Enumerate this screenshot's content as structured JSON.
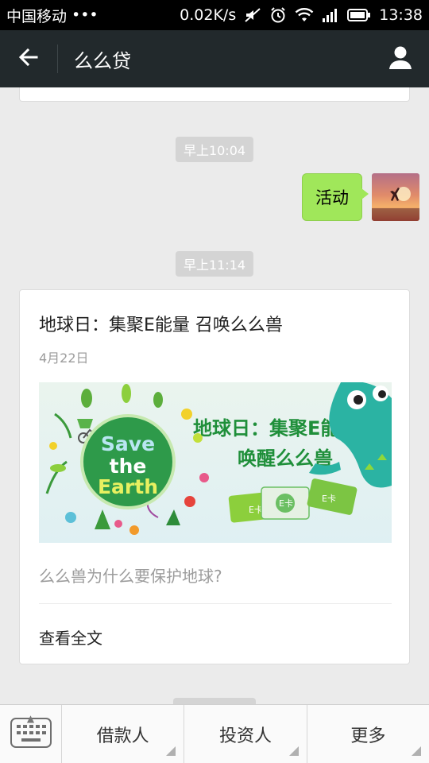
{
  "status_bar": {
    "carrier": "中国移动",
    "dots": "•••",
    "speed": "0.02K/s",
    "time": "13:38",
    "icons": [
      "mute-icon",
      "alarm-icon",
      "wifi-icon",
      "signal-icon",
      "battery-icon"
    ]
  },
  "header": {
    "title": "么么贷",
    "back_icon": "back-arrow-icon",
    "profile_icon": "person-icon"
  },
  "chat": {
    "time_1": "早上10:04",
    "sent_message": "活动",
    "time_2": "早上11:14",
    "article": {
      "title": "地球日：集聚E能量  召唤么么兽",
      "date": "4月22日",
      "image": {
        "badge_line1": "Save",
        "badge_line2": "the",
        "badge_line3": "Earth",
        "headline_1": "地球日：集聚E能量",
        "headline_2": "唤醒么么兽",
        "card_label_1": "E卡",
        "card_label_2": "E卡",
        "card_label_3": "E卡"
      },
      "summary": "么么兽为什么要保护地球?",
      "read_more": "查看全文"
    }
  },
  "bottom_menu": {
    "keyboard_icon": "keyboard-icon",
    "items": [
      "借款人",
      "投资人",
      "更多"
    ]
  },
  "colors": {
    "header_bg": "#22292c",
    "bubble_green": "#a0e75a",
    "chat_bg": "#ebebeb",
    "earth_green": "#2e9a4a",
    "headline_green": "#1f8f3a",
    "monster_teal": "#2bb3a3"
  }
}
